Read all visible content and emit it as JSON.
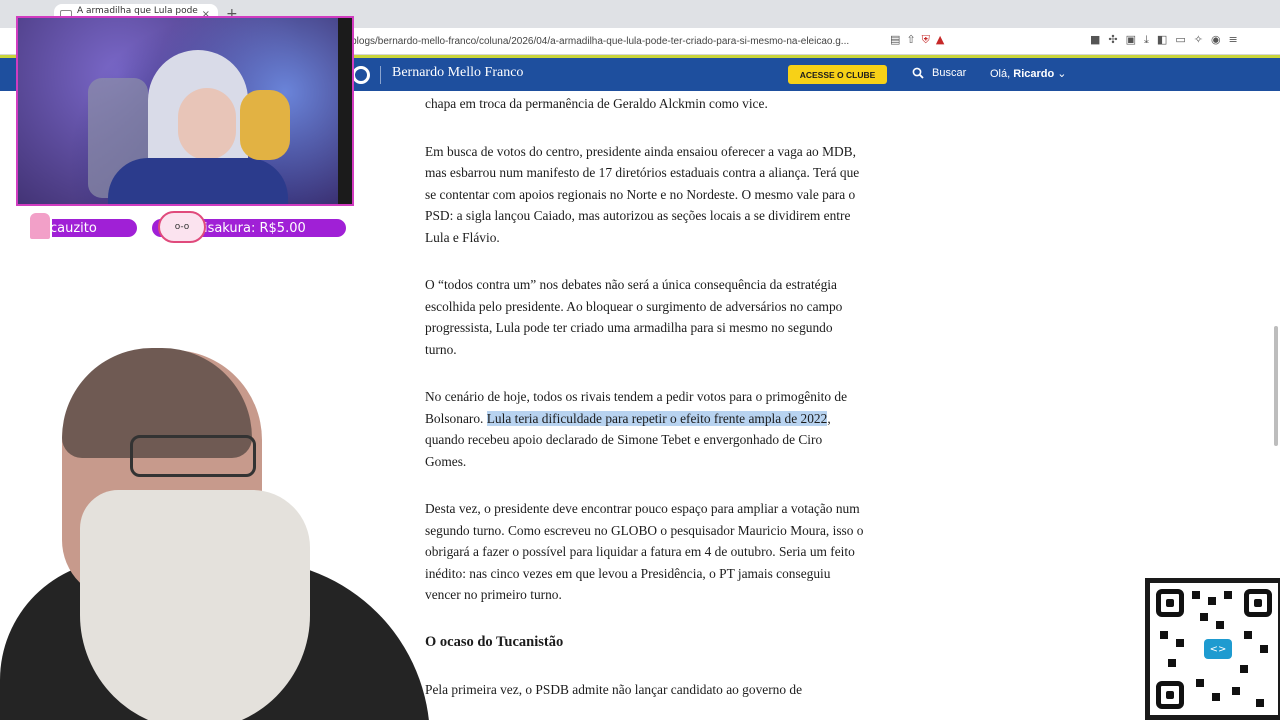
{
  "browser": {
    "tab_title": "A armadilha que Lula pode te...",
    "tab_close": "×",
    "new_tab": "+",
    "url": "m/blogs/bernardo-mello-franco/coluna/2026/04/a-armadilha-que-lula-pode-ter-criado-para-si-mesmo-na-eleicao.g...",
    "icons": [
      "reader-icon",
      "share-icon",
      "extension-shield-icon",
      "warning-icon"
    ]
  },
  "site": {
    "columnist": "Bernardo Mello Franco",
    "club_button": "ACESSE O CLUBE",
    "search_label": "Buscar",
    "greeting_prefix": "Olá,",
    "user_name": "Ricardo"
  },
  "article": {
    "p1": "chapa em troca da permanência de Geraldo Alckmin como vice.",
    "p2": "Em busca de votos do centro, presidente ainda ensaiou oferecer a vaga ao MDB, mas esbarrou num manifesto de 17 diretórios estaduais contra a aliança. Terá que se contentar com apoios regionais no Norte e no Nordeste. O mesmo vale para o PSD: a sigla lançou Caiado, mas autorizou as seções locais a se dividirem entre Lula e Flávio.",
    "p3": "O “todos contra um” nos debates não será a única consequência da estratégia escolhida pelo presidente. Ao bloquear o surgimento de adversários no campo progressista, Lula pode ter criado uma armadilha para si mesmo no segundo turno.",
    "p4_before": "No cenário de hoje, todos os rivais tendem a pedir votos para o primogênito de Bolsonaro. ",
    "p4_highlight": "Lula teria dificuldade para repetir o efeito frente ampla de 2022",
    "p4_after": ", quando recebeu apoio declarado de Simone Tebet e envergonhado de Ciro Gomes.",
    "p5": "Desta vez, o presidente deve encontrar pouco espaço para ampliar a votação num segundo turno. Como escreveu no GLOBO o pesquisador Mauricio Moura, isso o obrigará a fazer o possível para liquidar a fatura em 4 de outubro. Seria um feito inédito: nas cinco vezes em que levou a Presidência, o PT jamais conseguiu vencer no primeiro turno.",
    "subhead": "O ocaso do Tucanistão",
    "p6": "Pela primeira vez, o PSDB admite não lançar candidato ao governo de"
  },
  "overlay": {
    "badge1": "cauzito",
    "badge2": "oisakura: R$5.00",
    "mochi_face": "o-o"
  },
  "colors": {
    "site_header": "#1e4f9e",
    "club_button": "#f7d117",
    "highlight": "#b8d3f0",
    "badge": "#a020d6",
    "cam_border": "#d13cc0"
  }
}
